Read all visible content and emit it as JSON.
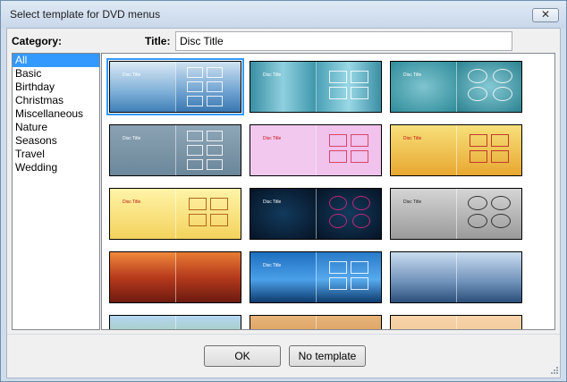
{
  "window": {
    "title": "Select template for DVD menus",
    "close_label": "✕"
  },
  "category": {
    "label": "Category:",
    "items": [
      "All",
      "Basic",
      "Birthday",
      "Christmas",
      "Miscellaneous",
      "Nature",
      "Seasons",
      "Travel",
      "Wedding"
    ],
    "selected": "All"
  },
  "title_field": {
    "label": "Title:",
    "value": "Disc Title"
  },
  "templates": [
    {
      "style": "blue-waves",
      "selected": true
    },
    {
      "style": "teal-gradient",
      "selected": false
    },
    {
      "style": "teal-ovals",
      "selected": false
    },
    {
      "style": "grey-blue",
      "selected": false
    },
    {
      "style": "birthday-pink",
      "selected": false
    },
    {
      "style": "christmas-gold",
      "selected": false
    },
    {
      "style": "christmas-tree",
      "selected": false
    },
    {
      "style": "dark-blue",
      "selected": false
    },
    {
      "style": "penguin-grey",
      "selected": false
    },
    {
      "style": "red-sky",
      "selected": false
    },
    {
      "style": "blue-forest",
      "selected": false
    },
    {
      "style": "winter-trees",
      "selected": false
    },
    {
      "style": "green-field",
      "selected": false
    },
    {
      "style": "brown-frame",
      "selected": false
    },
    {
      "style": "peach-texture",
      "selected": false
    }
  ],
  "buttons": {
    "ok": "OK",
    "no_template": "No template"
  },
  "thumb_text": {
    "disc_title": "Disc Title"
  },
  "colors": {
    "selection": "#3399ff",
    "window_frame": "#cfdceb"
  }
}
